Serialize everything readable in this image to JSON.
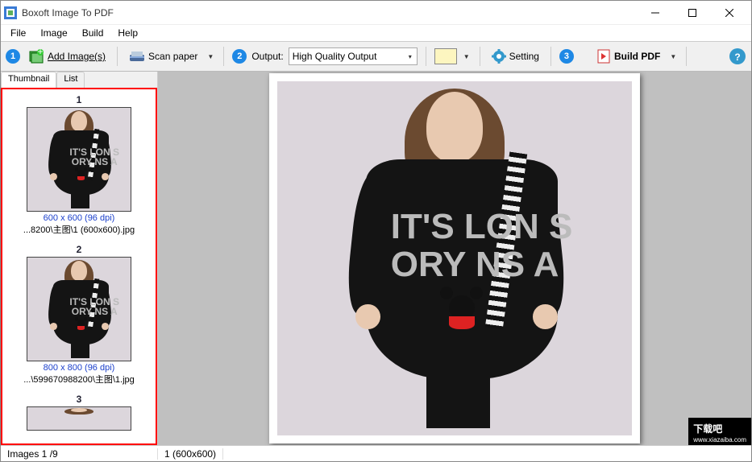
{
  "window": {
    "title": "Boxoft Image To PDF"
  },
  "menu": {
    "file": "File",
    "image": "Image",
    "build": "Build",
    "help": "Help"
  },
  "toolbar": {
    "step1": "1",
    "add_images": "Add Image(s)",
    "scan_paper": "Scan paper",
    "step2": "2",
    "output_label": "Output:",
    "output_value": "High Quality Output",
    "step3": "3",
    "setting": "Setting",
    "step4": "3",
    "build_pdf": "Build PDF"
  },
  "tabs": {
    "thumbnail": "Thumbnail",
    "list": "List"
  },
  "thumbnails": [
    {
      "num": "1",
      "meta": "600 x 600 (96 dpi)",
      "path": "...8200\\主图\\1 (600x600).jpg"
    },
    {
      "num": "2",
      "meta": "800 x 800 (96 dpi)",
      "path": "...\\599670988200\\主图\\1.jpg"
    },
    {
      "num": "3",
      "meta": "",
      "path": ""
    }
  ],
  "dress_text": "IT'S\nLON\nS ORY\n NS A",
  "status": {
    "images": "Images 1 /9",
    "preview_label": "1 (600x600)"
  },
  "watermark": {
    "big": "下载吧",
    "url": "www.xiazaiba.com"
  }
}
